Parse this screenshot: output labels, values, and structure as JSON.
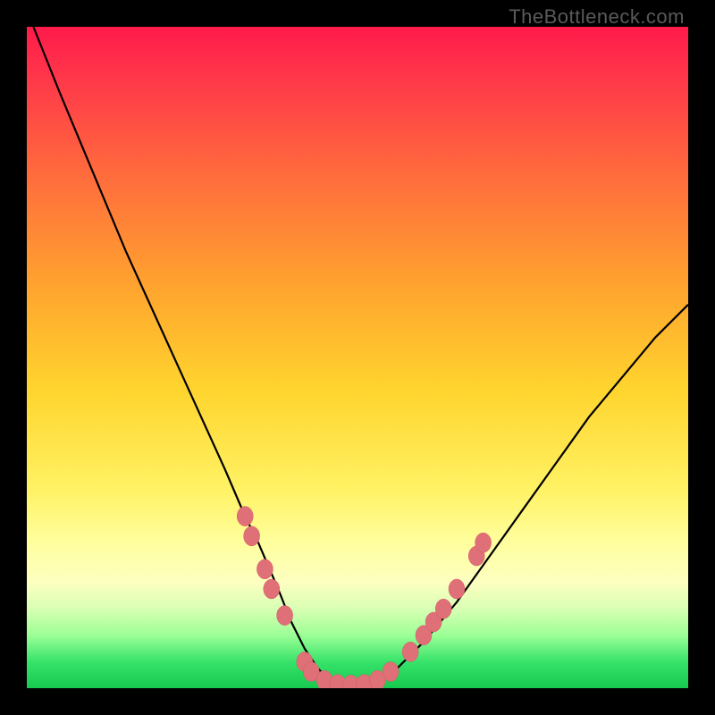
{
  "watermark": "TheBottleneck.com",
  "colors": {
    "gradient_top": "#ff1a4a",
    "gradient_mid": "#ffd52e",
    "gradient_bottom": "#17c94f",
    "curve": "#000000",
    "dots": "#e07078",
    "frame": "#000000"
  },
  "chart_data": {
    "type": "line",
    "title": "",
    "xlabel": "",
    "ylabel": "",
    "xlim": [
      0,
      100
    ],
    "ylim": [
      0,
      100
    ],
    "grid": false,
    "legend": false,
    "note": "Bottleneck curve; y≈0 indicates no bottleneck (green zone), y→100 indicates severe bottleneck (red). x is the relative component performance scale (arbitrary 0–100). Values estimated from pixel positions.",
    "series": [
      {
        "name": "bottleneck-curve",
        "x": [
          1,
          5,
          10,
          15,
          20,
          25,
          30,
          33,
          35,
          38,
          40,
          42,
          44,
          46,
          48,
          50,
          53,
          56,
          60,
          65,
          70,
          75,
          80,
          85,
          90,
          95,
          100
        ],
        "y": [
          100,
          90,
          78,
          66,
          55,
          44,
          33,
          26,
          22,
          15,
          10,
          6,
          3,
          1,
          0.5,
          0.5,
          1,
          3,
          7,
          13,
          20,
          27,
          34,
          41,
          47,
          53,
          58
        ]
      }
    ],
    "highlight_points": {
      "name": "sample-dots",
      "note": "Salmon dots clustered near the trough of the curve.",
      "points": [
        {
          "x": 33,
          "y": 26
        },
        {
          "x": 34,
          "y": 23
        },
        {
          "x": 36,
          "y": 18
        },
        {
          "x": 37,
          "y": 15
        },
        {
          "x": 39,
          "y": 11
        },
        {
          "x": 42,
          "y": 4
        },
        {
          "x": 43,
          "y": 2.5
        },
        {
          "x": 45,
          "y": 1.2
        },
        {
          "x": 47,
          "y": 0.6
        },
        {
          "x": 49,
          "y": 0.5
        },
        {
          "x": 51,
          "y": 0.6
        },
        {
          "x": 53,
          "y": 1.2
        },
        {
          "x": 55,
          "y": 2.5
        },
        {
          "x": 58,
          "y": 5.5
        },
        {
          "x": 60,
          "y": 8
        },
        {
          "x": 61.5,
          "y": 10
        },
        {
          "x": 63,
          "y": 12
        },
        {
          "x": 65,
          "y": 15
        },
        {
          "x": 68,
          "y": 20
        },
        {
          "x": 69,
          "y": 22
        }
      ]
    }
  }
}
